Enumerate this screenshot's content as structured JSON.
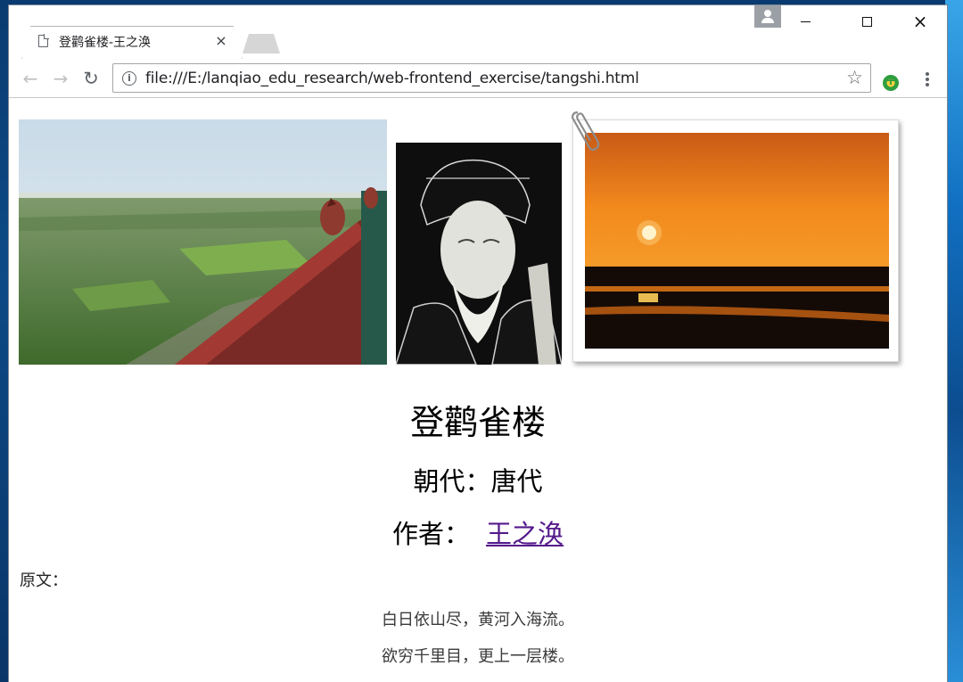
{
  "browser": {
    "tab_title": "登鹳雀楼-王之涣",
    "tab_close": "×",
    "url": "file:///E:/lanqiao_edu_research/web-frontend_exercise/tangshi.html"
  },
  "window_controls": {
    "close_glyph": "×"
  },
  "icons": {
    "back": "←",
    "forward": "→",
    "reload": "↻",
    "info": "i",
    "star": "☆"
  },
  "page": {
    "title": "登鹳雀楼",
    "dynasty": "朝代：唐代",
    "author_label": "作者：",
    "author_name": "王之涣",
    "original_label": "原文：",
    "poem_lines": [
      "白日依山尽，黄河入海流。",
      "欲穷千里目，更上一层楼。"
    ]
  }
}
